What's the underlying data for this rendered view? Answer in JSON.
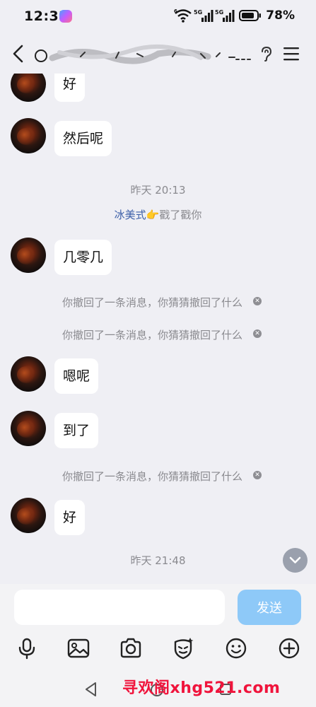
{
  "status_bar": {
    "time": "12:32",
    "battery_percent": "78%",
    "network_labels": [
      "5G",
      "5G"
    ],
    "wifi_badge": "6"
  },
  "nav": {
    "back_icon": "chevron-left-icon",
    "hearing_icon": "ear-icon",
    "menu_icon": "menu-icon"
  },
  "messages": {
    "m1": "好",
    "m2": "然后呢",
    "ts1": "昨天 20:13",
    "poke_name": "冰美式",
    "poke_emoji": "👉",
    "poke_text": "戳了戳你",
    "m3": "几零几",
    "recall_text": "你撤回了一条消息，你猜猜撤回了什么",
    "m4": "嗯呢",
    "m5": "到了",
    "m6": "好",
    "ts2": "昨天 21:48"
  },
  "composer": {
    "input_value": "",
    "send_label": "发送"
  },
  "toolbar_icons": [
    "microphone-icon",
    "image-icon",
    "camera-icon",
    "emoji-shield-icon",
    "smiley-icon",
    "plus-icon"
  ],
  "watermark": "寻欢阁xhg521.com",
  "colors": {
    "background": "#efeff4",
    "bubble": "#ffffff",
    "send_button": "#8ec9f8",
    "poke_name": "#3c5fa8",
    "watermark": "#f0143c"
  }
}
